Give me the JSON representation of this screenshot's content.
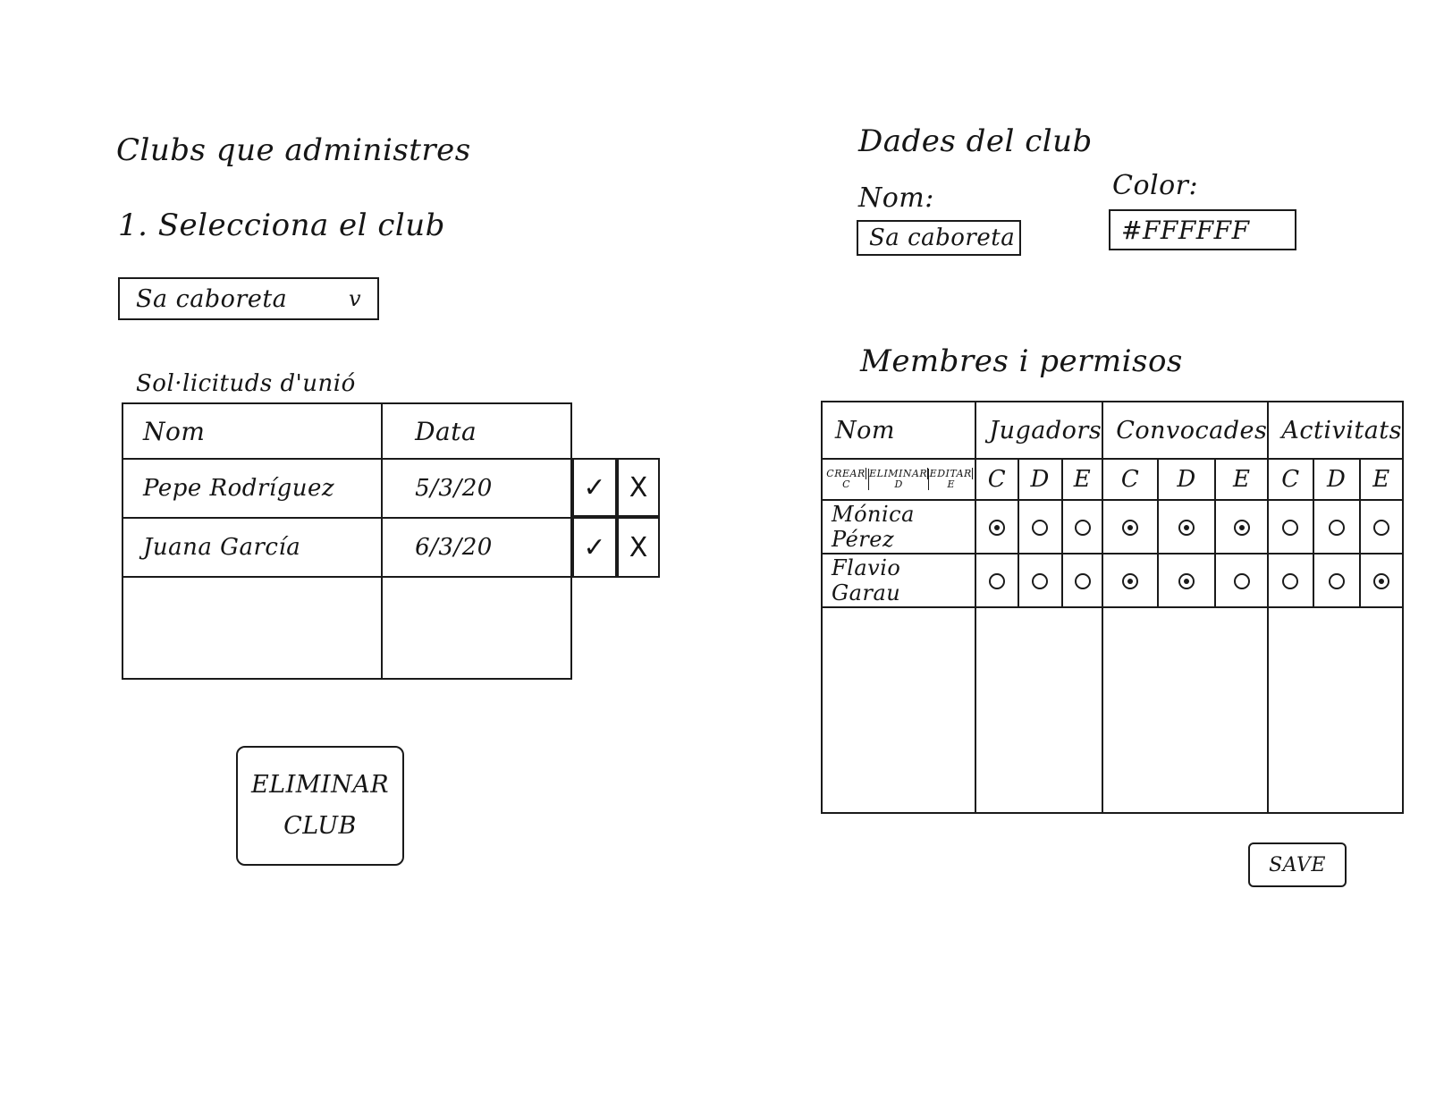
{
  "left": {
    "heading": "Clubs que administres",
    "step_label": "1. Selecciona el club",
    "club_select": {
      "value": "Sa caboreta",
      "chevron": "v"
    },
    "requests_caption": "Sol·licituds d'unió",
    "requests_table": {
      "columns": [
        "Nom",
        "Data"
      ],
      "rows": [
        {
          "name": "Pepe Rodríguez",
          "date": "5/3/20"
        },
        {
          "name": "Juana García",
          "date": "6/3/20"
        }
      ],
      "accept_glyph": "✓",
      "reject_glyph": "X"
    },
    "delete_button": {
      "line1": "ELIMINAR",
      "line2": "CLUB"
    }
  },
  "right": {
    "heading": "Dades del club",
    "name_label": "Nom:",
    "name_value": "Sa caboreta",
    "color_label": "Color:",
    "color_value": "#FFFFFF",
    "members_heading": "Membres i permisos",
    "members_table": {
      "name_column": "Nom",
      "groups": [
        "Jugadors",
        "Convocades",
        "Activitats"
      ],
      "legend": [
        {
          "word": "CREAR",
          "letter": "C"
        },
        {
          "word": "ELIMINAR",
          "letter": "D"
        },
        {
          "word": "EDITAR",
          "letter": "E"
        }
      ],
      "sub_columns": [
        "C",
        "D",
        "E"
      ],
      "rows": [
        {
          "name": "Mónica Pérez",
          "perms": [
            true,
            false,
            false,
            true,
            true,
            true,
            false,
            false,
            false
          ]
        },
        {
          "name": "Flavio Garau",
          "perms": [
            false,
            false,
            false,
            true,
            true,
            false,
            false,
            false,
            true
          ]
        }
      ]
    },
    "save_button": "SAVE"
  },
  "colors": {
    "ink": "#151515",
    "background": "#ffffff"
  }
}
